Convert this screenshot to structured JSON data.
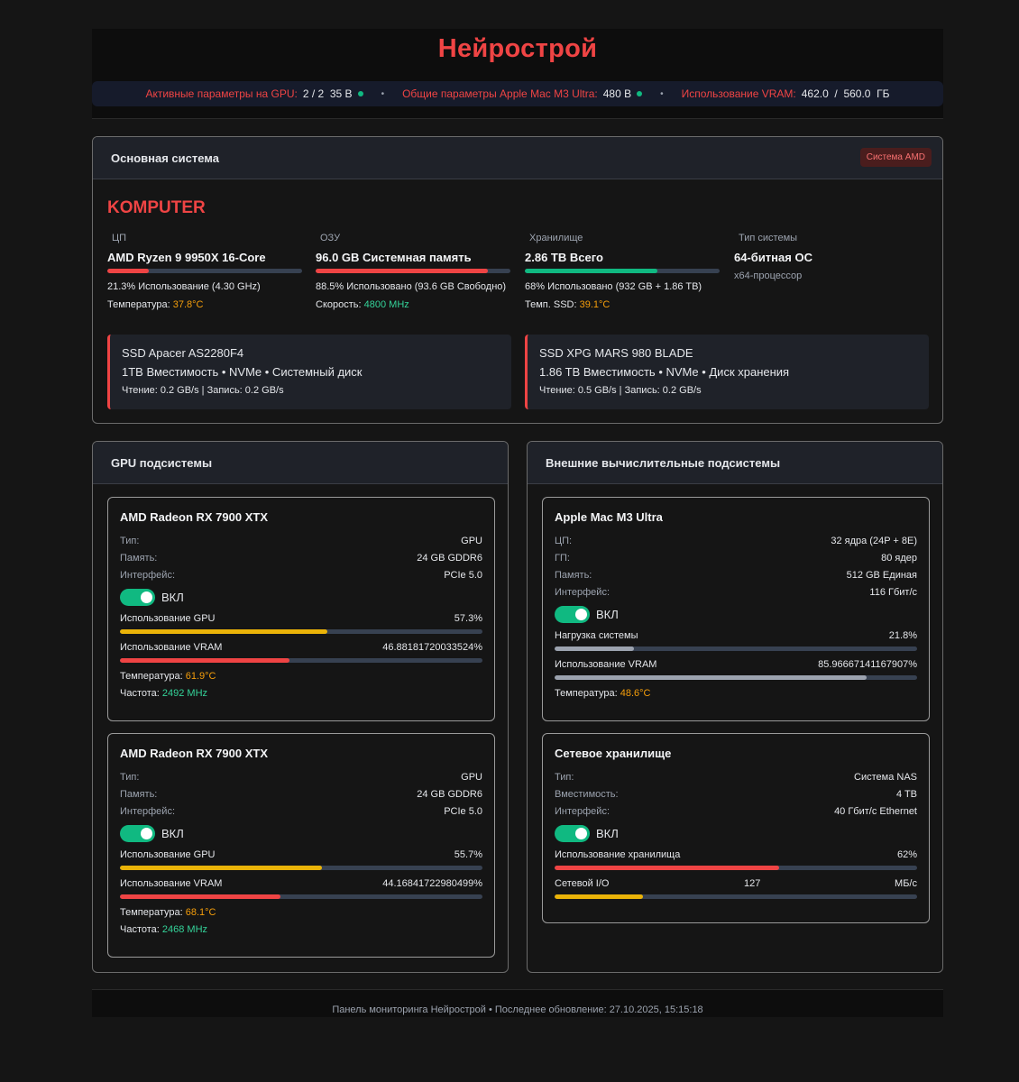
{
  "app": {
    "title": "Нейрострой"
  },
  "status": {
    "gpu_label": "Активные параметры на GPU:",
    "gpu_count": "2 / 2",
    "gpu_params": "35 B",
    "mac_label": "Общие параметры Apple Mac M3 Ultra:",
    "mac_params": "480 B",
    "vram_label": "Использование VRAM:",
    "vram_used": "462.0",
    "vram_sep": "/",
    "vram_total": "560.0",
    "vram_unit": "ГБ",
    "dot_color": "#10b981"
  },
  "main_system": {
    "header": "Основная система",
    "badge": "Система AMD",
    "computer_name": "KOMPUTER",
    "cpu": {
      "label": "ЦП",
      "name": "AMD Ryzen 9 9950X 16-Core",
      "usage_fraction": 0.213,
      "usage_text": "21.3% Использование (4.30 GHz)",
      "temp_label": "Температура:",
      "temp_value": "37.8°C",
      "bar_color": "#ef4444"
    },
    "ram": {
      "label": "ОЗУ",
      "name": "96.0 GB Системная память",
      "usage_fraction": 0.885,
      "usage_text": "88.5% Использовано (93.6 GB Свободно)",
      "speed_label": "Скорость:",
      "speed_value": "4800 MHz",
      "bar_color": "#ef4444"
    },
    "storage": {
      "label": "Хранилище",
      "name": "2.86 TB Всего",
      "usage_fraction": 0.68,
      "usage_text": "68% Использовано (932 GB + 1.86 TB)",
      "temp_label": "Темп. SSD:",
      "temp_value": "39.1°C",
      "bar_color": "#10b981"
    },
    "os": {
      "label": "Тип системы",
      "name": "64-битная ОС",
      "sub": "x64-процессор"
    },
    "disks": [
      {
        "name": "SSD Apacer AS2280F4",
        "capacity": "1TB Вместимость • NVMe • Системный диск",
        "io": "Чтение: 0.2 GB/s | Запись: 0.2 GB/s"
      },
      {
        "name": "SSD XPG MARS 980 BLADE",
        "capacity": "1.86 TB Вместимость • NVMe • Диск хранения",
        "io": "Чтение: 0.5 GB/s | Запись: 0.2 GB/s"
      }
    ]
  },
  "gpu_panel": {
    "header": "GPU подсистемы",
    "cards": [
      {
        "title": "AMD Radeon RX 7900 XTX",
        "type_label": "Тип:",
        "type_value": "GPU",
        "mem_label": "Память:",
        "mem_value": "24 GB GDDR6",
        "iface_label": "Интерфейс:",
        "iface_value": "PCIe 5.0",
        "toggle_label": "ВКЛ",
        "gpu_usage_label": "Использование GPU",
        "gpu_usage_text": "57.3%",
        "gpu_usage_fraction": 0.573,
        "vram_label": "Использование VRAM",
        "vram_text": "46.88181720033524%",
        "vram_fraction": 0.4688,
        "temp_label": "Температура:",
        "temp_value": "61.9°C",
        "freq_label": "Частота:",
        "freq_value": "2492 MHz"
      },
      {
        "title": "AMD Radeon RX 7900 XTX",
        "type_label": "Тип:",
        "type_value": "GPU",
        "mem_label": "Память:",
        "mem_value": "24 GB GDDR6",
        "iface_label": "Интерфейс:",
        "iface_value": "PCIe 5.0",
        "toggle_label": "ВКЛ",
        "gpu_usage_label": "Использование GPU",
        "gpu_usage_text": "55.7%",
        "gpu_usage_fraction": 0.557,
        "vram_label": "Использование VRAM",
        "vram_text": "44.16841722980499%",
        "vram_fraction": 0.4417,
        "temp_label": "Температура:",
        "temp_value": "68.1°C",
        "freq_label": "Частота:",
        "freq_value": "2468 MHz"
      }
    ]
  },
  "external_panel": {
    "header": "Внешние вычислительные подсистемы",
    "mac": {
      "title": "Apple Mac M3 Ultra",
      "cpu_label": "ЦП:",
      "cpu_value": "32 ядра (24P + 8E)",
      "gpu_label": "ГП:",
      "gpu_value": "80 ядер",
      "mem_label": "Память:",
      "mem_value": "512 GB Единая",
      "iface_label": "Интерфейс:",
      "iface_value": "116 Гбит/с",
      "toggle_label": "ВКЛ",
      "load_label": "Нагрузка системы",
      "load_text": "21.8%",
      "load_fraction": 0.218,
      "vram_label": "Использование VRAM",
      "vram_text": "85.96667141167907%",
      "vram_fraction": 0.8597,
      "temp_label": "Температура:",
      "temp_value": "48.6°C"
    },
    "nas": {
      "title": "Сетевое хранилище",
      "type_label": "Тип:",
      "type_value": "Система NAS",
      "cap_label": "Вместимость:",
      "cap_value": "4 TB",
      "iface_label": "Интерфейс:",
      "iface_value": "40 Гбит/с Ethernet",
      "toggle_label": "ВКЛ",
      "storage_label": "Использование хранилища",
      "storage_text": "62%",
      "storage_fraction": 0.62,
      "net_label": "Сетевой I/O",
      "net_value": "127",
      "net_unit": "МБ/с",
      "net_fraction": 0.245
    }
  },
  "colors": {
    "accent_red": "#ef4444",
    "green": "#10b981",
    "yellow": "#eab308",
    "gray": "#9ca3af"
  },
  "footer": {
    "text": "Панель мониторинга Нейрострой • Последнее обновление: 27.10.2025, 15:15:18"
  }
}
